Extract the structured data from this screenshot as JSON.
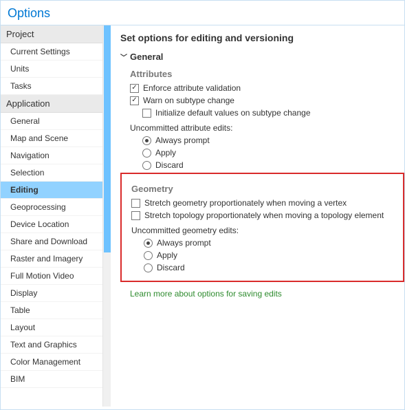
{
  "title": "Options",
  "sidebar": {
    "groups": [
      {
        "label": "Project",
        "items": [
          "Current Settings",
          "Units",
          "Tasks"
        ]
      },
      {
        "label": "Application",
        "items": [
          "General",
          "Map and Scene",
          "Navigation",
          "Selection",
          "Editing",
          "Geoprocessing",
          "Device Location",
          "Share and Download",
          "Raster and Imagery",
          "Full Motion Video",
          "Display",
          "Table",
          "Layout",
          "Text and Graphics",
          "Color Management",
          "BIM"
        ]
      }
    ],
    "selected": "Editing"
  },
  "main": {
    "heading": "Set options for editing and versioning",
    "general_label": "General",
    "attributes": {
      "label": "Attributes",
      "enforce": "Enforce attribute validation",
      "warn": "Warn on subtype change",
      "initialize": "Initialize default values on subtype change",
      "uncommitted_label": "Uncommitted attribute edits:",
      "options": {
        "always": "Always prompt",
        "apply": "Apply",
        "discard": "Discard"
      }
    },
    "geometry": {
      "label": "Geometry",
      "stretch_geom": "Stretch geometry proportionately when moving a vertex",
      "stretch_topo": "Stretch topology proportionately when moving a topology element",
      "uncommitted_label": "Uncommitted geometry edits:",
      "options": {
        "always": "Always prompt",
        "apply": "Apply",
        "discard": "Discard"
      }
    },
    "link": "Learn more about options for saving edits"
  }
}
